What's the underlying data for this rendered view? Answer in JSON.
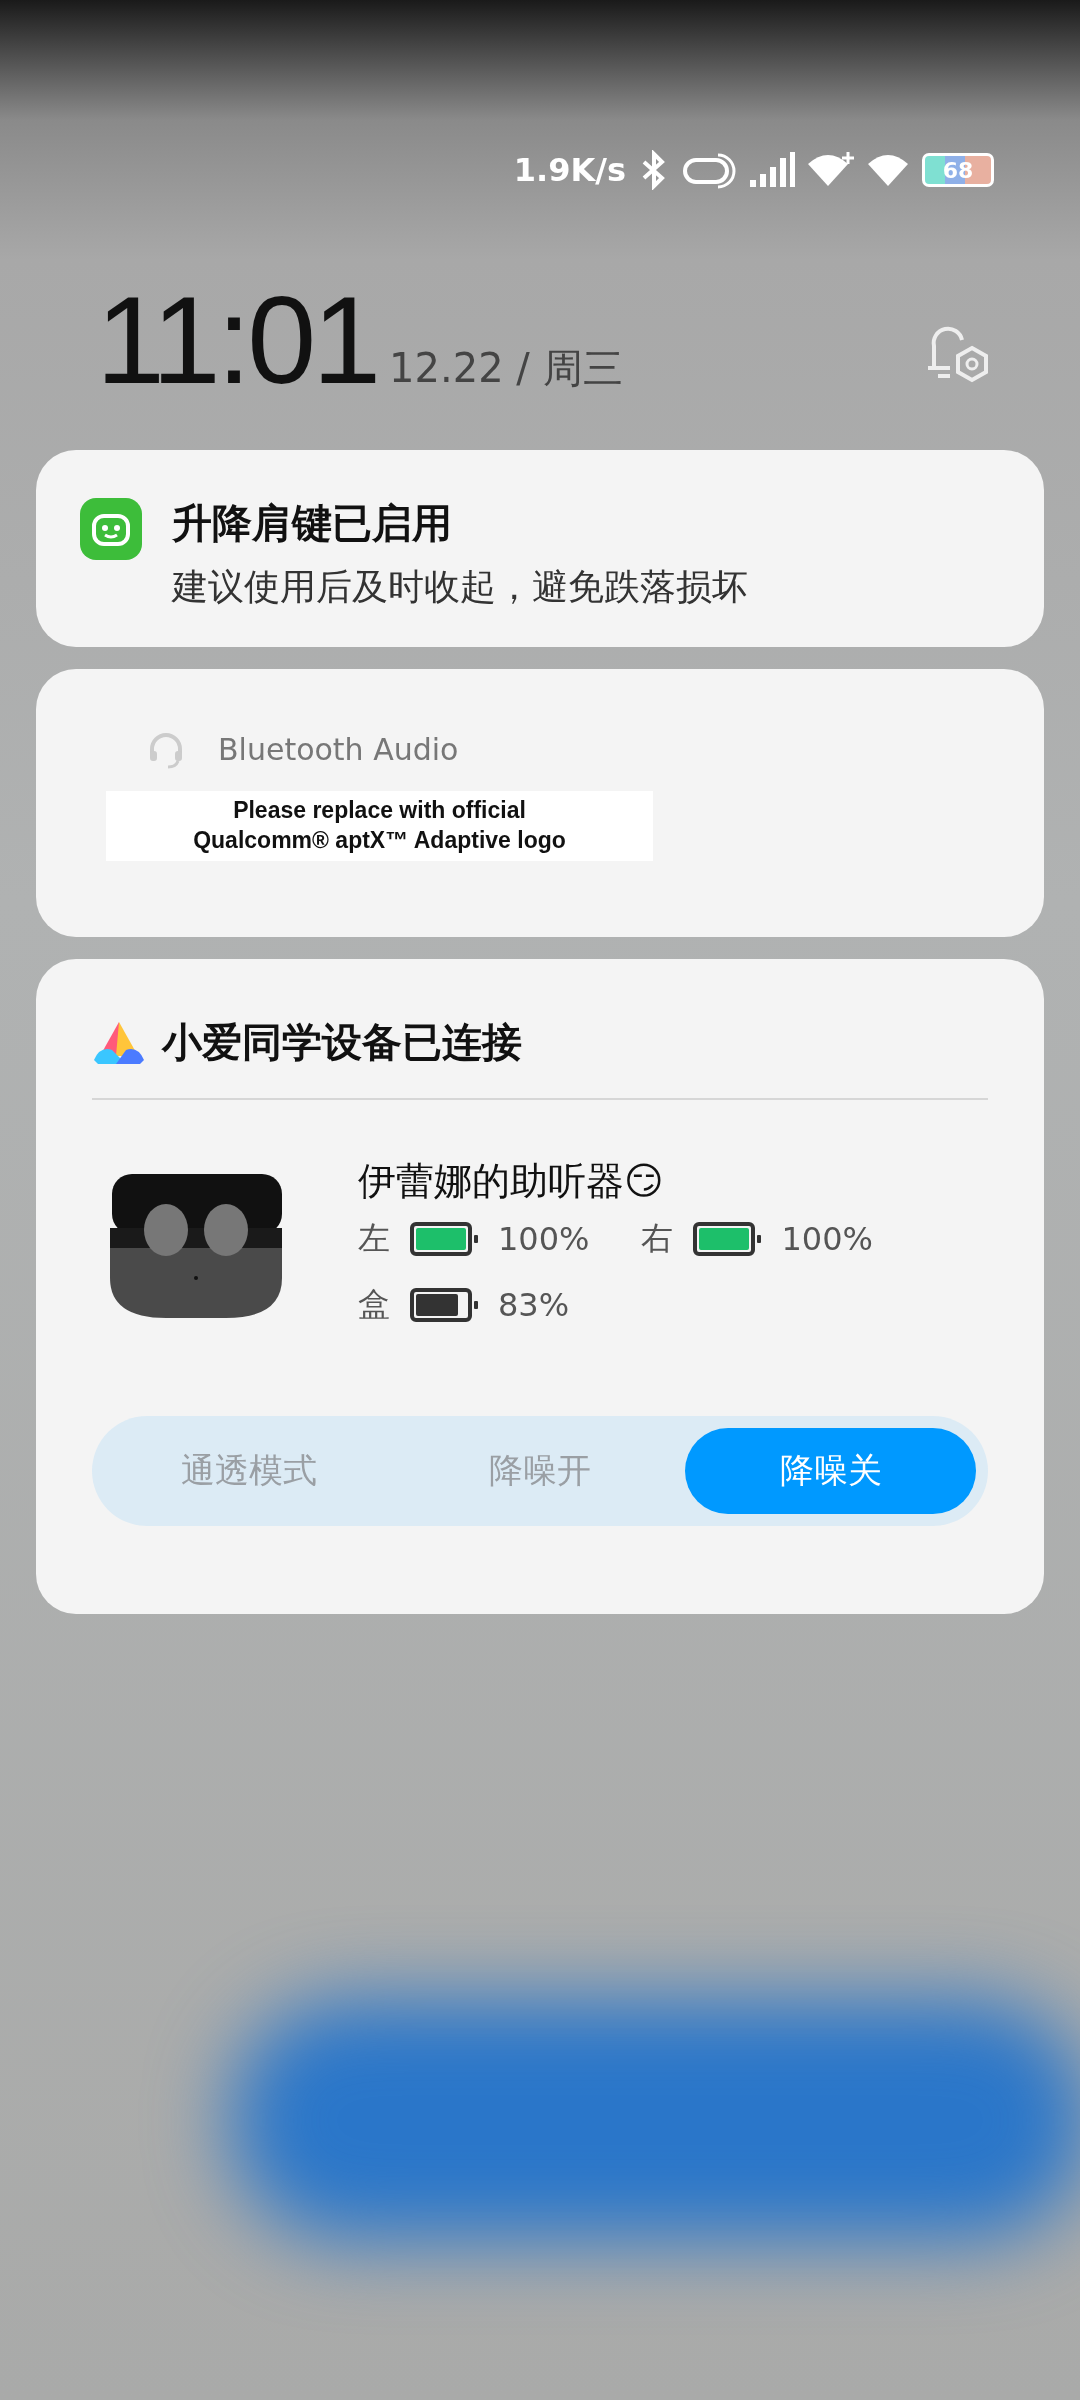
{
  "status_bar": {
    "speed": "1.9K/s",
    "battery": "68"
  },
  "lock_clock": {
    "time": "11:01",
    "date": "12.22 / 周三"
  },
  "notifications": [
    {
      "kind": "app",
      "title": "升降肩键已启用",
      "body": "建议使用后及时收起，避免跌落损坏"
    },
    {
      "kind": "codec",
      "title": "Bluetooth Audio",
      "logo_lines": [
        "Please replace with official",
        "Qualcomm® aptX™ Adaptive logo"
      ]
    }
  ],
  "device_card": {
    "title": "小爱同学设备已连接",
    "device_name": "伊蕾娜的助听器😏",
    "batteries": [
      {
        "label": "左",
        "level": 1,
        "reading": "100%",
        "color": "#1dbf6a"
      },
      {
        "label": "右",
        "level": 1,
        "reading": "100%",
        "color": "#1dbf6a"
      },
      {
        "label": "盒",
        "level": 0.83,
        "reading": "83%",
        "color": "#333333"
      }
    ],
    "modes": [
      {
        "label": "通透模式",
        "selected": false
      },
      {
        "label": "降噪开",
        "selected": false
      },
      {
        "label": "降噪关",
        "selected": true
      }
    ]
  }
}
